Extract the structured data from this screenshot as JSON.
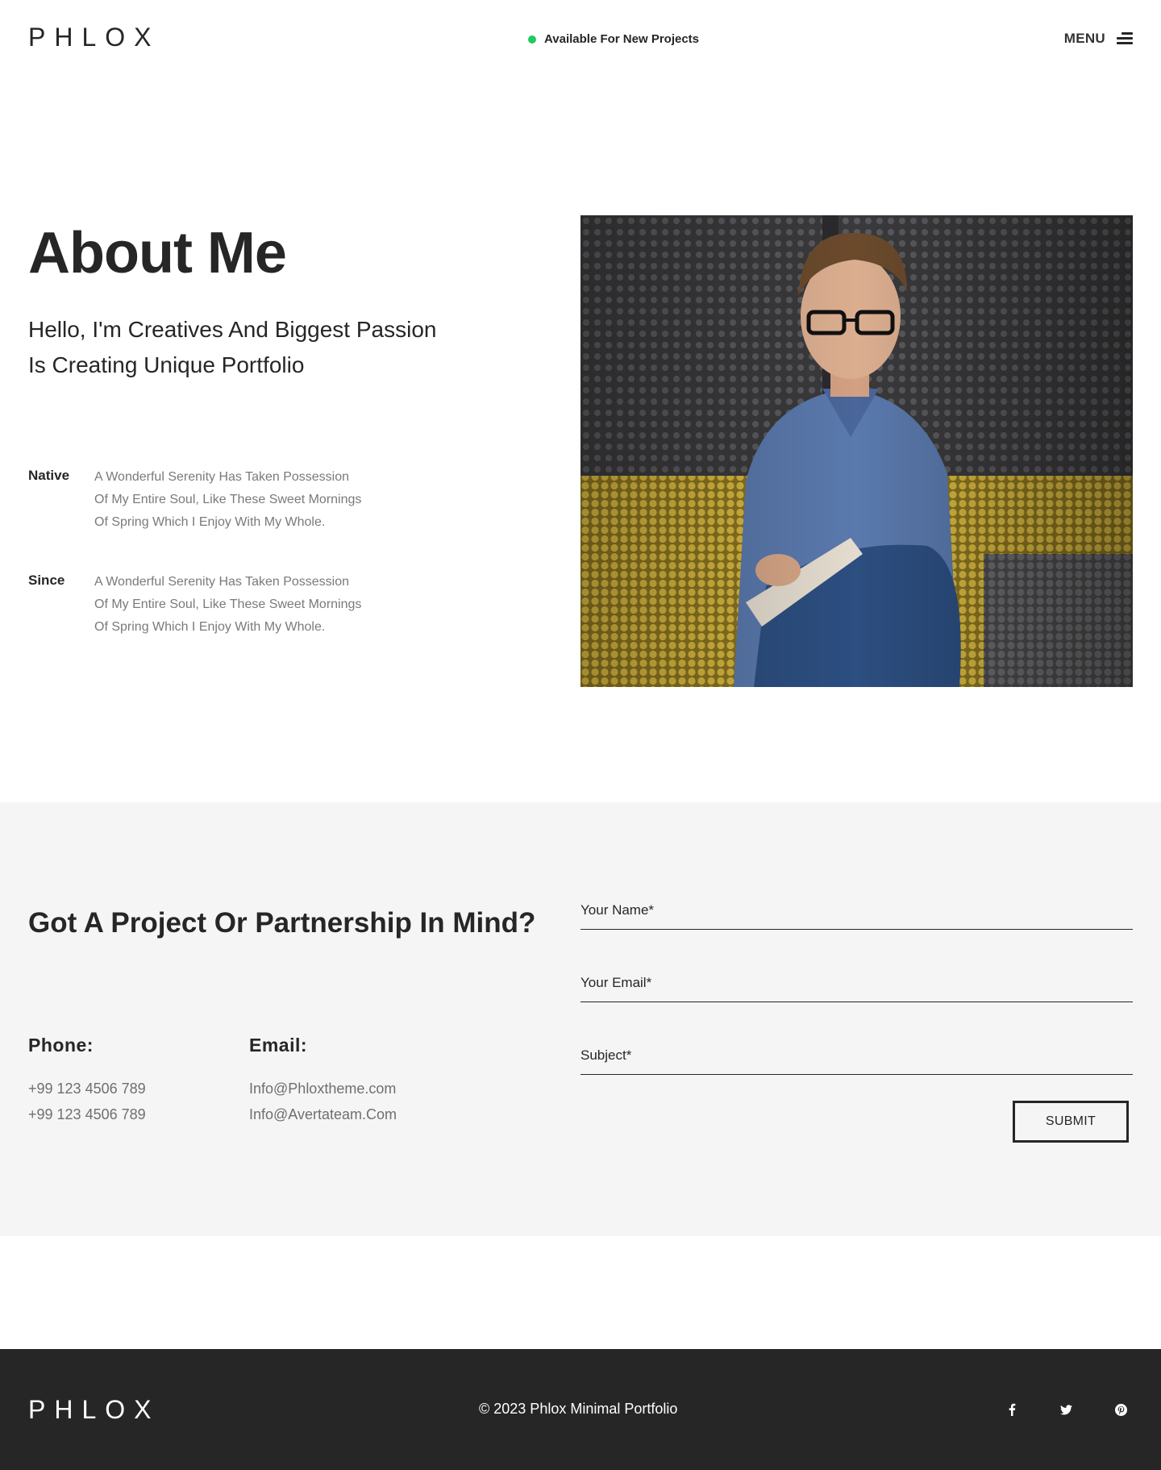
{
  "header": {
    "logo_text": "PHLOX",
    "availability": "Available For New Projects",
    "menu_label": "MENU"
  },
  "about": {
    "title": "About Me",
    "subtitle_line1": "Hello, I'm Creatives And Biggest Passion",
    "subtitle_line2": "Is Creating Unique Portfolio",
    "items": [
      {
        "label": "Native",
        "line1": "A Wonderful Serenity Has Taken Possession",
        "line2": "Of My Entire Soul, Like These Sweet Mornings",
        "line3": "Of Spring Which I Enjoy With My Whole."
      },
      {
        "label": "Since",
        "line1": "A Wonderful Serenity Has Taken Possession",
        "line2": "Of My Entire Soul, Like These Sweet Mornings",
        "line3": "Of Spring Which I Enjoy With My Whole."
      }
    ]
  },
  "contact": {
    "title": "Got A Project Or Partnership In Mind?",
    "phone_label": "Phone:",
    "phones": [
      "+99 123 4506 789",
      "+99 123 4506 789"
    ],
    "email_label": "Email:",
    "emails": [
      "Info@Phloxtheme.com",
      "Info@Avertateam.Com"
    ],
    "form": {
      "name_placeholder": "Your Name*",
      "email_placeholder": "Your Email*",
      "subject_placeholder": "Subject*",
      "submit_label": "SUBMIT"
    }
  },
  "footer": {
    "logo_text": "PHLOX",
    "copyright": "© 2023 Phlox Minimal Portfolio",
    "social_icons": [
      "facebook-icon",
      "twitter-icon",
      "pinterest-icon"
    ]
  },
  "colors": {
    "accent_green": "#1ecb5e",
    "dark": "#262626",
    "light_section": "#f5f5f5",
    "muted_text": "#7a7a7a"
  }
}
